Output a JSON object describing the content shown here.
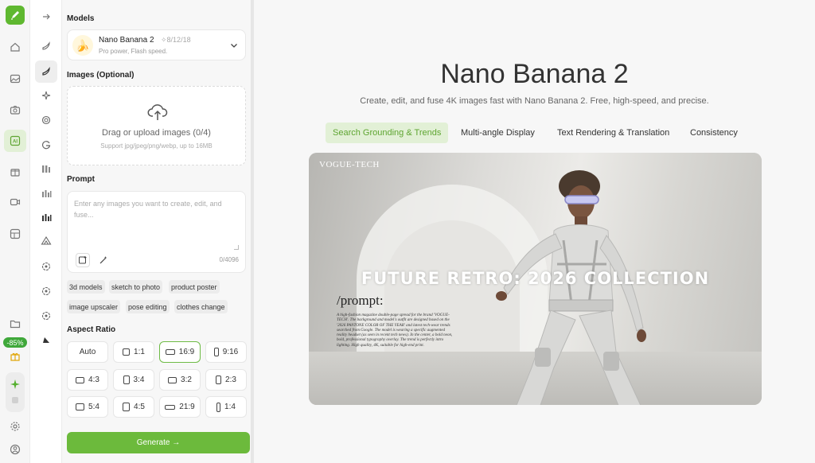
{
  "rail": {
    "icons": [
      "brush-logo-icon",
      "home-icon",
      "image-icon",
      "camera-icon",
      "ai-icon",
      "shop-icon",
      "video-icon",
      "template-icon",
      "folder-icon",
      "gift-icon",
      "sparkle-icon",
      "settings-icon",
      "user-icon"
    ],
    "credit_badge": "-85%"
  },
  "models": {
    "label": "Models",
    "name": "Nano Banana 2",
    "meta": "8/12/18",
    "sub": "Pro power, Flash speed."
  },
  "images": {
    "label": "Images (Optional)",
    "upload_text": "Drag or upload images  (0/4)",
    "upload_hint": "Support jpg/jpeg/png/webp, up to 16MB"
  },
  "prompt": {
    "label": "Prompt",
    "placeholder": "Enter any images you want to create, edit, and fuse...",
    "count": "0/4096"
  },
  "chips": [
    "3d models",
    "sketch to photo",
    "product poster",
    "image upscaler",
    "pose editing",
    "clothes change"
  ],
  "aspect": {
    "label": "Aspect Ratio",
    "options": [
      "Auto",
      "1:1",
      "16:9",
      "9:16",
      "4:3",
      "3:4",
      "3:2",
      "2:3",
      "5:4",
      "4:5",
      "21:9",
      "1:4"
    ],
    "selected": "16:9"
  },
  "generate_label": "Generate →",
  "hero": {
    "title": "Nano Banana 2",
    "subtitle": "Create, edit, and fuse 4K images fast with Nano Banana 2. Free, high-speed, and precise.",
    "tabs": [
      "Search Grounding & Trends",
      "Multi-angle Display",
      "Text Rendering & Translation",
      "Consistency"
    ],
    "active_tab": "Search Grounding & Trends",
    "image": {
      "brand": "VOGUE-TECH",
      "headline": "FUTURE RETRO: 2026 COLLECTION",
      "prompt_title": "/prompt:",
      "prompt_body": "A high-fashion magazine double-page spread for the brand 'VOGUE-TECH'. The background and model's outfit are designed based on the '2026 PANTONE COLOR OF THE YEAR' and latest tech-wear trends searched from Google. The model is wearing a specific augmented reality headset (as seen in recent tech news). In the center, a bold neon, bold, professional typography overlay. The trend is perfectly intro lighting. High quality, 4K, suitable for high-end print."
    }
  },
  "colors": {
    "accent": "#6cba3c",
    "accent_light": "#e2f0d6"
  }
}
